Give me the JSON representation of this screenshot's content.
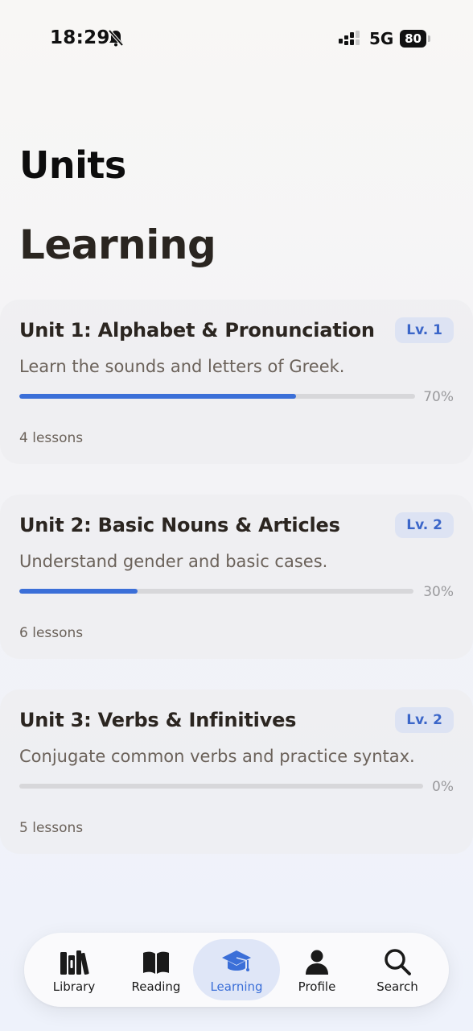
{
  "status_bar": {
    "time": "18:29",
    "network": "5G",
    "battery": "80",
    "icons": [
      "bell-off-icon",
      "signal-icon",
      "battery-icon"
    ]
  },
  "header": {
    "title": "Units",
    "section_title": "Learning"
  },
  "units": [
    {
      "title": "Unit 1: Alphabet & Pronunciation",
      "level": "Lv. 1",
      "description": "Learn the sounds and letters of Greek.",
      "progress": 0.7,
      "progress_label": "70%",
      "lessons": "4 lessons"
    },
    {
      "title": "Unit 2: Basic Nouns & Articles",
      "level": "Lv. 2",
      "description": "Understand gender and basic cases.",
      "progress": 0.3,
      "progress_label": "30%",
      "lessons": "6 lessons"
    },
    {
      "title": "Unit 3: Verbs & Infinitives",
      "level": "Lv. 2",
      "description": "Conjugate common verbs and practice syntax.",
      "progress": 0.0,
      "progress_label": "0%",
      "lessons": "5 lessons"
    }
  ],
  "tab_bar": {
    "items": [
      {
        "label": "Library",
        "icon": "library-icon",
        "active": false
      },
      {
        "label": "Reading",
        "icon": "book-open-icon",
        "active": false
      },
      {
        "label": "Learning",
        "icon": "graduation-cap-icon",
        "active": true
      },
      {
        "label": "Profile",
        "icon": "person-icon",
        "active": false
      },
      {
        "label": "Search",
        "icon": "search-icon",
        "active": false
      }
    ]
  },
  "colors": {
    "accent": "#3b6fd8",
    "badge_bg": "#dde3f3",
    "track": "#d7d7da"
  }
}
